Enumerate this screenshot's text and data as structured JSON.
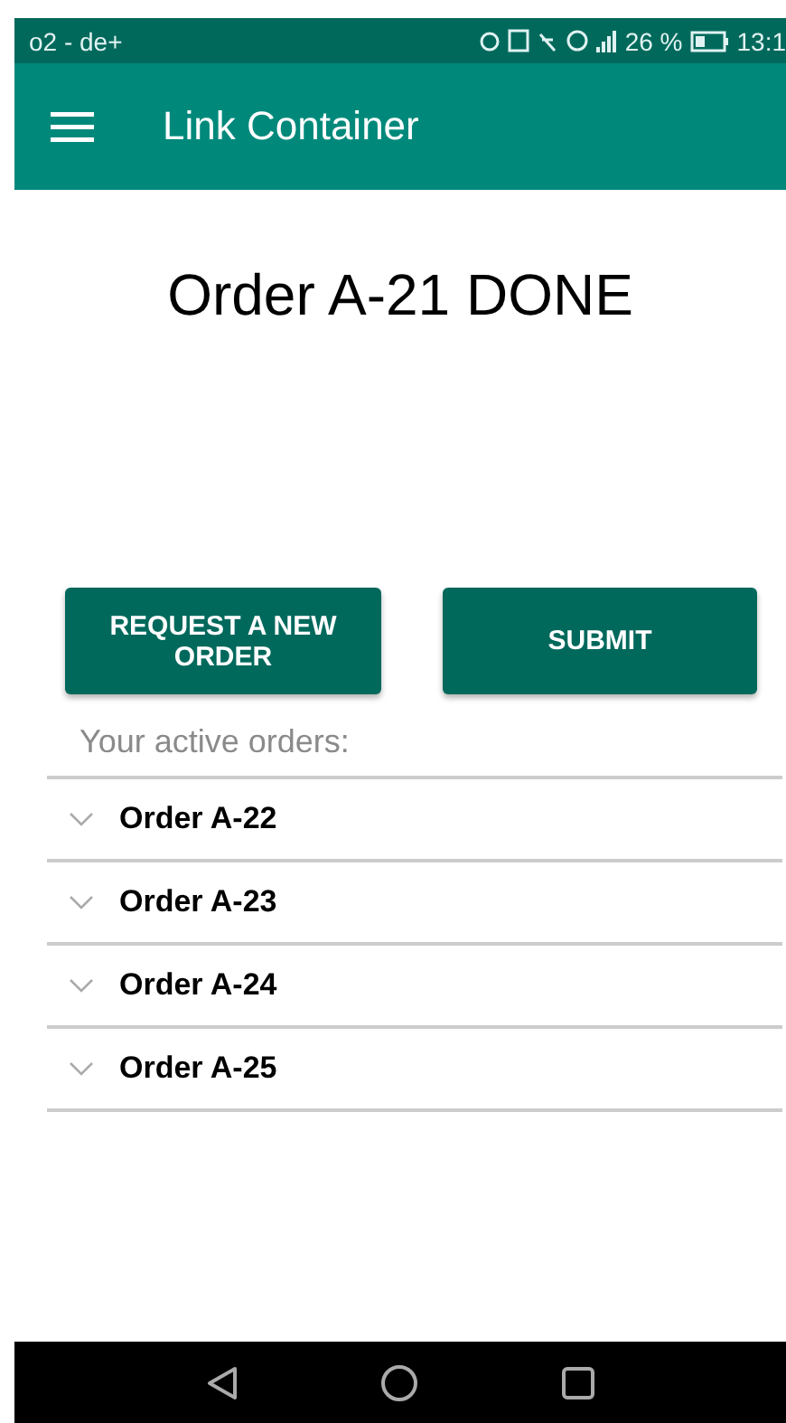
{
  "status_bar": {
    "carrier": "o2 - de+",
    "battery": "26 %",
    "time": "13:1"
  },
  "app_bar": {
    "title": "Link Container"
  },
  "heading": "Order A-21 DONE",
  "buttons": [
    "REQUEST A NEW ORDER",
    "SUBMIT"
  ],
  "orders_label": "Your active orders:",
  "orders": [
    {
      "label": "Order A-22",
      "expanded": false
    },
    {
      "label": "Order A-23",
      "expanded": false
    },
    {
      "label": "Order A-24",
      "expanded": false
    },
    {
      "label": "Order A-25",
      "expanded": false
    }
  ]
}
